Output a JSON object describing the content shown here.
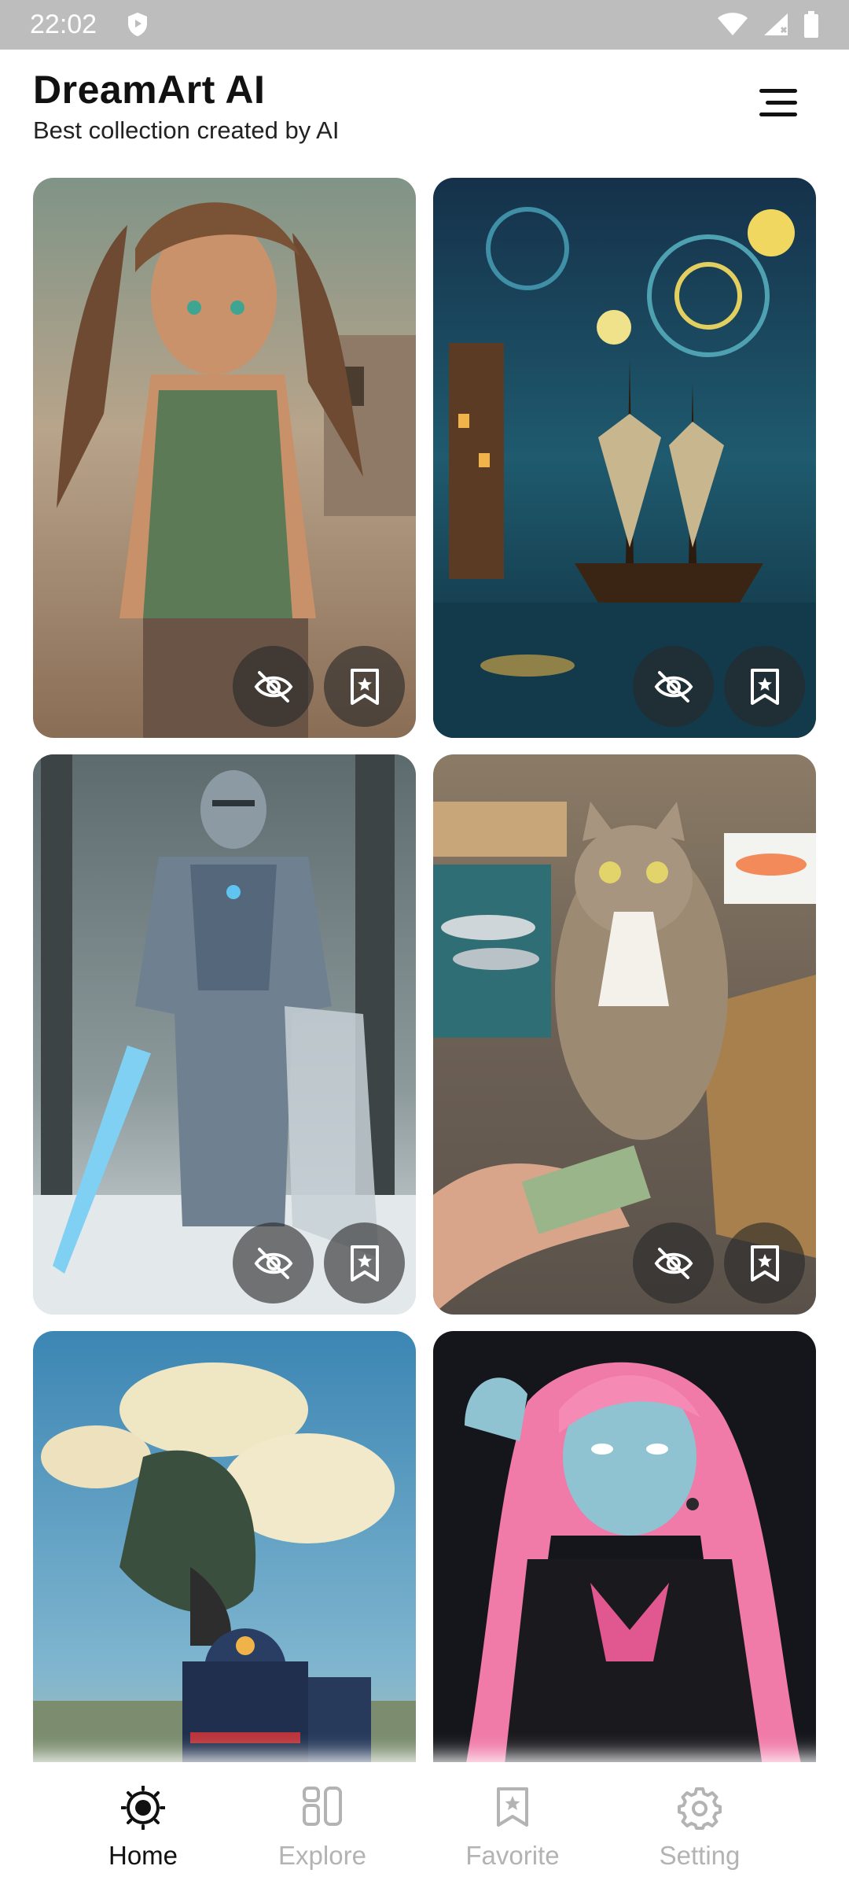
{
  "status_bar": {
    "time": "22:02"
  },
  "header": {
    "title": "DreamArt AI",
    "subtitle": "Best collection created by AI",
    "menu_icon": "menu-icon"
  },
  "cards": [
    {
      "subject": "warrior woman with dreadlocks",
      "hide_icon": "eye-off-icon",
      "save_icon": "bookmark-icon"
    },
    {
      "subject": "starry night sailing ship",
      "hide_icon": "eye-off-icon",
      "save_icon": "bookmark-icon"
    },
    {
      "subject": "armored knight in snow",
      "hide_icon": "eye-off-icon",
      "save_icon": "bookmark-icon"
    },
    {
      "subject": "cat at fish market",
      "hide_icon": "eye-off-icon",
      "save_icon": "bookmark-icon"
    },
    {
      "subject": "steam train and clouds"
    },
    {
      "subject": "neon pink haired girl"
    }
  ],
  "bottom_nav": {
    "items": [
      {
        "label": "Home",
        "icon": "home-target-icon",
        "active": true
      },
      {
        "label": "Explore",
        "icon": "explore-grid-icon",
        "active": false
      },
      {
        "label": "Favorite",
        "icon": "bookmark-icon",
        "active": false
      },
      {
        "label": "Setting",
        "icon": "gear-icon",
        "active": false
      }
    ]
  },
  "colors": {
    "status_bar": "#bdbdbd",
    "text_primary": "#111111",
    "nav_inactive": "#b3b3b3"
  }
}
